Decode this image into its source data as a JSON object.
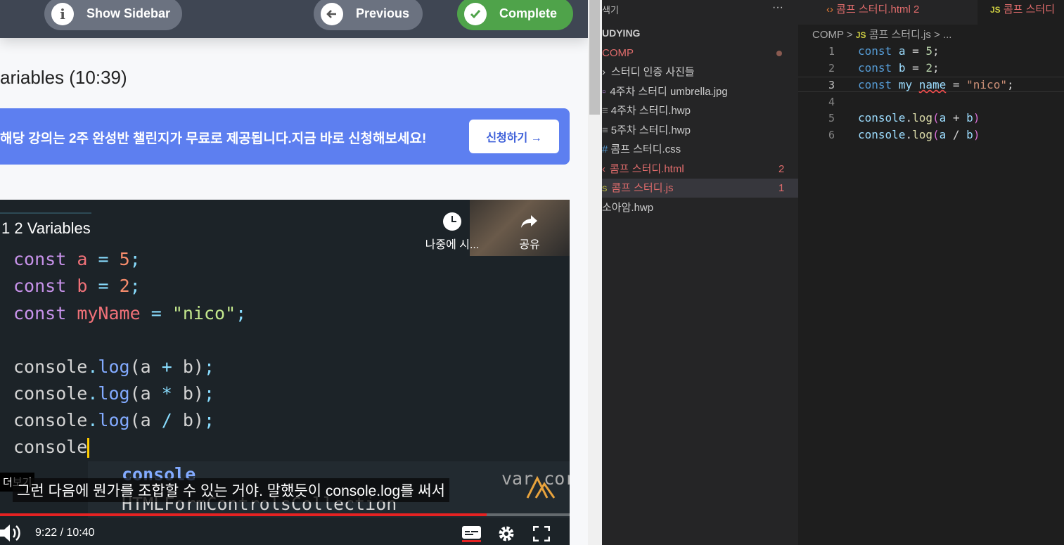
{
  "topbar": {
    "show_sidebar": "Show Sidebar",
    "previous": "Previous",
    "complete": "Complete"
  },
  "lecture": {
    "title": "ariables (10:39)"
  },
  "banner": {
    "text": "해당 강의는 2주 완성반 챌린지가 무료로 제공됩니다.지금 바로 신청해보세요!",
    "button": "신청하기 →"
  },
  "video": {
    "title": "1 2 Variables",
    "watch_later": "나중에 시...",
    "share": "공유",
    "more": "더보기",
    "caption": "그런 다음에 뭔가를 조합할 수 있는 거야. 말했듯이 console.log를 써서",
    "time": "9:22 / 10:40",
    "progress_fraction": 0.854,
    "code": {
      "kw": "const",
      "a": "a",
      "b": "b",
      "myName": "myName",
      "five": "5",
      "two": "2",
      "nico": "\"nico\"",
      "console": "console",
      "log": "log",
      "plus": "+",
      "star": "*",
      "slash": "/",
      "autocomplete1": "console",
      "autocomplete2": "HTMLFormControlsCollection",
      "var_hint": "var cor"
    }
  },
  "explorer": {
    "header": "색기",
    "more": "···",
    "section": "UDYING",
    "folder": "COMP",
    "items": [
      {
        "label": "스터디 인증 사진들",
        "badge": ""
      },
      {
        "label": "4주차 스터디 umbrella.jpg",
        "badge": ""
      },
      {
        "label": "4주차 스터디.hwp",
        "badge": ""
      },
      {
        "label": "5주차 스터디.hwp",
        "badge": ""
      },
      {
        "label": "콤프 스터디.css",
        "badge": ""
      },
      {
        "label": "콤프 스터디.html",
        "badge": "2"
      },
      {
        "label": "콤프 스터디.js",
        "badge": "1"
      },
      {
        "label": "소아암.hwp",
        "badge": ""
      }
    ]
  },
  "editor": {
    "tab1": "콤프 스터디.html 2",
    "tab2_icon": "JS",
    "tab2": "콤프 스터디",
    "breadcrumb": {
      "folder": "COMP",
      "sep": ">",
      "icon": "JS",
      "file": "콤프 스터디.js",
      "tail": "> ..."
    },
    "line_numbers": [
      "1",
      "2",
      "3",
      "4",
      "5",
      "6"
    ],
    "lines": {
      "const": "const",
      "a": "a",
      "b": "b",
      "my": "my",
      "name": "name",
      "eq": " = ",
      "five": "5",
      "two": "2",
      "nico": "\"nico\"",
      "semi": ";",
      "console": "console",
      "log": "log"
    }
  },
  "colors": {
    "complete": "#4fa34a",
    "banner": "#5d7ff0",
    "progress": "#e52222"
  }
}
